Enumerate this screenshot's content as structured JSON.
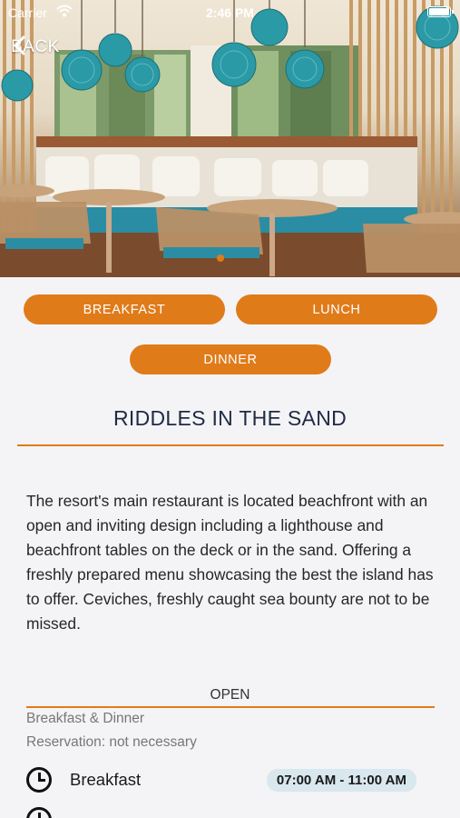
{
  "status_bar": {
    "carrier": "Carrier",
    "time": "2:46 PM"
  },
  "nav": {
    "back_label": "BACK"
  },
  "meal_buttons": {
    "breakfast": "BREAKFAST",
    "lunch": "LUNCH",
    "dinner": "DINNER"
  },
  "restaurant": {
    "name": "RIDDLES IN THE SAND",
    "description": "The resort's main restaurant is located beachfront with an open and inviting design including a lighthouse and beachfront tables on the deck or in the sand. Offering a freshly prepared menu showcasing the best the island has to offer. Ceviches, freshly caught sea bounty are not to be missed."
  },
  "hours": {
    "status": "OPEN",
    "service": "Breakfast & Dinner",
    "reservation": "Reservation: not necessary",
    "rows": [
      {
        "meal": "Breakfast",
        "time": "07:00 AM - 11:00 AM"
      }
    ]
  },
  "colors": {
    "accent": "#e07b1a",
    "title": "#1f2a44",
    "badge": "#d9e7ef"
  },
  "icons": {
    "back": "chevron-left-icon",
    "clock": "clock-icon",
    "wifi": "wifi-icon",
    "battery": "battery-icon"
  }
}
